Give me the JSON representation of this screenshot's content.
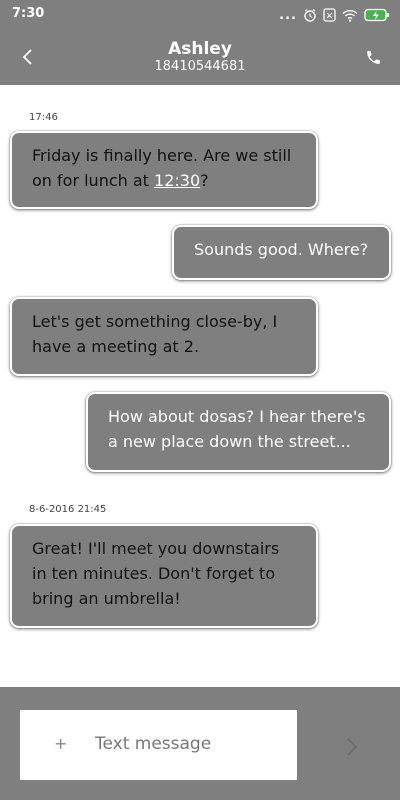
{
  "status_bar": {
    "time": "7:30",
    "more": "..."
  },
  "header": {
    "contact_name": "Ashley",
    "phone_number": "18410544681"
  },
  "messages": [
    {
      "timestamp": "17:46",
      "direction": "incoming",
      "before": "Friday is finally here. Are we still on for lunch at ",
      "link": "12:30",
      "after": "?"
    },
    {
      "direction": "outgoing",
      "text": "Sounds good. Where?"
    },
    {
      "direction": "incoming",
      "text": "Let's get something close-by, I have a meeting at 2."
    },
    {
      "direction": "outgoing",
      "text": "How about dosas? I hear there's a new place down the street..."
    },
    {
      "timestamp": "8-6-2016 21:45",
      "direction": "incoming",
      "text": "Great! I'll meet you downstairs in ten minutes. Don't forget to bring an umbrella!"
    }
  ],
  "composer": {
    "placeholder": "Text message",
    "plus": "+"
  },
  "colors": {
    "bar_gray": "#7f7f7f",
    "bubble_gray": "#7f7f7f",
    "background": "#ffffff"
  }
}
